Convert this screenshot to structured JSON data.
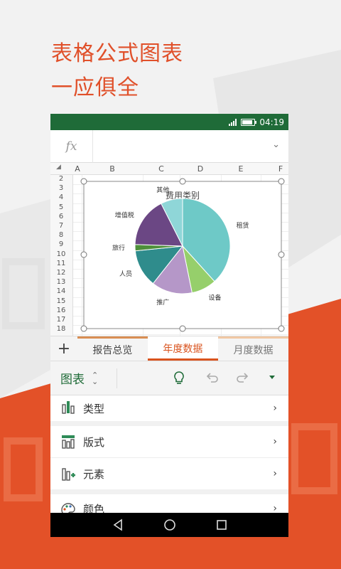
{
  "headline": {
    "line1": "表格公式图表",
    "line2": "一应俱全"
  },
  "status": {
    "time": "04:19"
  },
  "formula_bar": {
    "fx_label": "fx",
    "value": ""
  },
  "grid": {
    "columns": [
      "A",
      "B",
      "C",
      "D",
      "E",
      "F"
    ],
    "rows": [
      "2",
      "3",
      "4",
      "5",
      "6",
      "7",
      "8",
      "9",
      "10",
      "11",
      "12",
      "13",
      "14",
      "15",
      "16",
      "17",
      "18"
    ]
  },
  "chart_data": {
    "type": "pie",
    "title": "费用类别",
    "labels": [
      "租赁",
      "设备",
      "推广",
      "人员",
      "旅行",
      "增值税",
      "其他"
    ],
    "values": [
      36,
      8,
      13,
      12,
      2,
      16,
      7
    ],
    "colors": [
      "#6ec9c7",
      "#96cf6b",
      "#b597c8",
      "#2f8c8c",
      "#4e8f3a",
      "#6b4784",
      "#8fd6d8"
    ]
  },
  "sheet_tabs": {
    "tab1": "报告总览",
    "tab2": "年度数据",
    "tab3": "月度数据"
  },
  "toolbar": {
    "title": "图表"
  },
  "menu": {
    "item1": "类型",
    "item2": "版式",
    "item3": "元素",
    "item4": "颜色"
  }
}
